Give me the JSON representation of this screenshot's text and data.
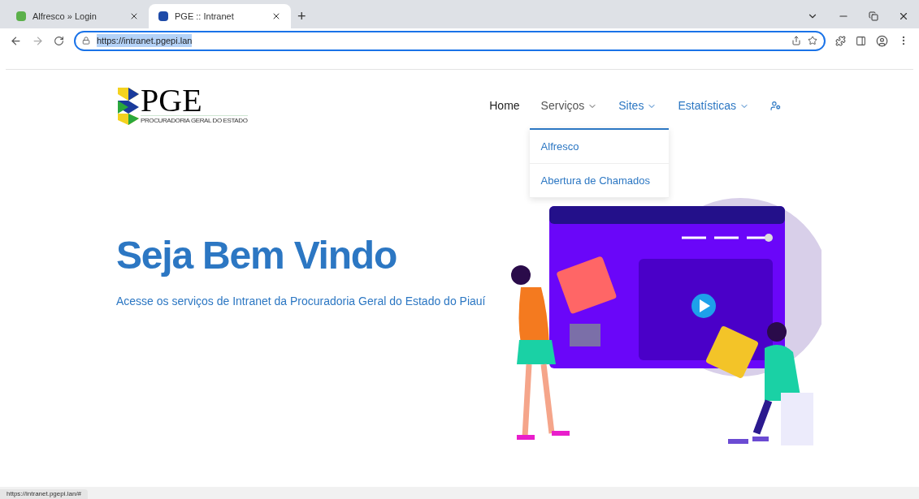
{
  "browser": {
    "tabs": [
      {
        "title": "Alfresco » Login",
        "selected": false
      },
      {
        "title": "PGE :: Intranet",
        "selected": true
      }
    ],
    "new_tab": "+",
    "url": "https://intranet.pgepi.lan",
    "status_url": "https://intranet.pgepi.lan/#"
  },
  "logo": {
    "title": "PGE",
    "subtitle": "PROCURADORIA GERAL DO ESTADO"
  },
  "nav": [
    {
      "label": "Home",
      "kind": "link",
      "selected": true
    },
    {
      "label": "Serviços",
      "kind": "dropdown",
      "selected": false,
      "expanded": true,
      "items": [
        "Alfresco",
        "Abertura de Chamados"
      ]
    },
    {
      "label": "Sites",
      "kind": "dropdown",
      "selected": false,
      "expanded": false
    },
    {
      "label": "Estatísticas",
      "kind": "dropdown",
      "selected": false,
      "expanded": false
    },
    {
      "kind": "user"
    }
  ],
  "hero": {
    "title": "Seja Bem Vindo",
    "subtitle": "Acesse os serviços de Intranet da Procuradoria Geral do Estado do Piauí"
  }
}
